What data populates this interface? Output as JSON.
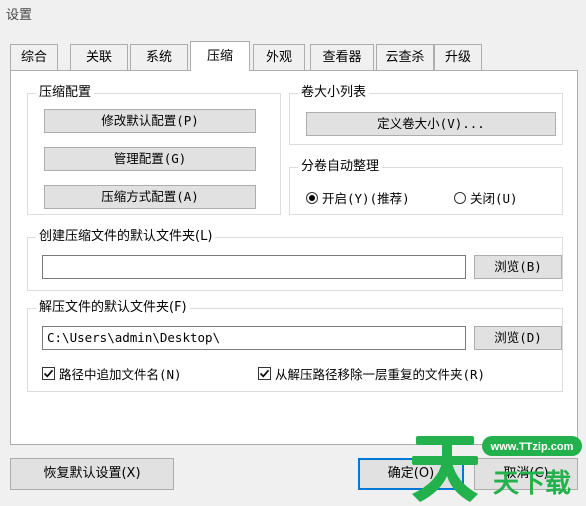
{
  "window": {
    "title": "设置"
  },
  "tabs": [
    {
      "label": "综合",
      "active": false
    },
    {
      "label": "关联",
      "active": false
    },
    {
      "label": "系统",
      "active": false
    },
    {
      "label": "压缩",
      "active": true
    },
    {
      "label": "外观",
      "active": false
    },
    {
      "label": "查看器",
      "active": false
    },
    {
      "label": "云查杀",
      "active": false
    },
    {
      "label": "升级",
      "active": false
    }
  ],
  "compress_config": {
    "legend": "压缩配置",
    "edit_default": "修改默认配置(P)",
    "manage": "管理配置(G)",
    "method": "压缩方式配置(A)"
  },
  "volume_list": {
    "legend": "卷大小列表",
    "define": "定义卷大小(V)..."
  },
  "auto_arrange": {
    "legend": "分卷自动整理",
    "on_label": "开启(Y)(推荐)",
    "off_label": "关闭(U)",
    "selected": "on"
  },
  "default_folder": {
    "legend": "创建压缩文件的默认文件夹(L)",
    "value": "",
    "browse": "浏览(B)"
  },
  "extract_folder": {
    "legend": "解压文件的默认文件夹(F)",
    "value": "C:\\Users\\admin\\Desktop\\",
    "browse": "浏览(D)",
    "append_name": "路径中追加文件名(N)",
    "append_name_checked": true,
    "remove_dup": "从解压路径移除一层重复的文件夹(R)",
    "remove_dup_checked": true
  },
  "footer": {
    "restore": "恢复默认设置(X)",
    "ok": "确定(O)",
    "cancel": "取消(C)"
  },
  "watermark": {
    "url": "www.TTzip.com",
    "text": "天下载",
    "brand_color": "#22b14c"
  }
}
